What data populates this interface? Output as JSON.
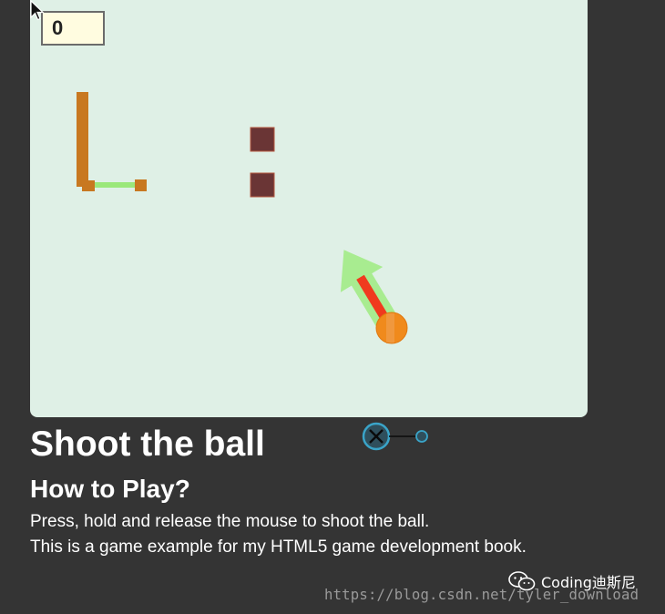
{
  "game": {
    "score": "0",
    "colors": {
      "canvas_bg": "#dff0e6",
      "wall": "#c87820",
      "wall_link": "#9ae87a",
      "block": "#6a3535",
      "ball": "#f08a1c",
      "aim_arrow": "#a8ec90",
      "power_bar": "#f03a1e"
    }
  },
  "page": {
    "title": "Shoot the ball",
    "how_to_heading": "How to Play?",
    "description_line1": "Press, hold and release the mouse to shoot the ball.",
    "description_line2": "This is a game example for my HTML5 game development book."
  },
  "watermark": {
    "brand": "Coding迪斯尼",
    "url": "https://blog.csdn.net/tyler_download"
  },
  "icons": {
    "cursor": "mouse-pointer-icon",
    "close": "close-circle-icon",
    "wechat": "wechat-icon"
  }
}
